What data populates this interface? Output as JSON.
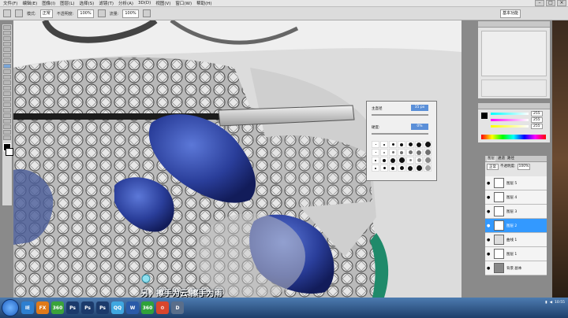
{
  "menubar": {
    "items": [
      "文件(F)",
      "编辑(E)",
      "图像(I)",
      "图层(L)",
      "选择(S)",
      "滤镜(T)",
      "分析(A)",
      "3D(D)",
      "视图(V)",
      "窗口(W)",
      "帮助(H)"
    ]
  },
  "options_bar": {
    "mode_label": "模式:",
    "mode_value": "正常",
    "opacity_label": "不透明度:",
    "opacity_value": "100%",
    "flow_label": "流量:",
    "flow_value": "100%",
    "workspace_label": "基本功能"
  },
  "brush_popup": {
    "diameter_label": "主直径",
    "diameter_value": "35 px",
    "hardness_label": "硬度:",
    "hardness_value": "0%"
  },
  "color_panel": {
    "values": [
      "255",
      "255",
      "255"
    ]
  },
  "layers_panel": {
    "tabs": [
      "图层",
      "通道",
      "路径"
    ],
    "mode": "正常",
    "opacity_label": "不透明度:",
    "opacity_value": "100%",
    "layers": [
      {
        "name": "图层 5"
      },
      {
        "name": "图层 4"
      },
      {
        "name": "图层 3"
      },
      {
        "name": "图层 2",
        "selected": true
      },
      {
        "name": "曲线 1"
      },
      {
        "name": "图层 1"
      },
      {
        "name": "背景 副本"
      }
    ]
  },
  "subtitle": "另，擦手为云  擦手为雨",
  "taskbar": {
    "apps": [
      "IE",
      "FX",
      "360",
      "Ps",
      "Ps",
      "Ps",
      "QQ",
      "W",
      "360",
      "⚙",
      "D"
    ],
    "clock": "10:55"
  },
  "colors": {
    "selected_layer": "#3399ff",
    "taskbar": "#2a5088",
    "sapphire": "#2a3e9a"
  }
}
